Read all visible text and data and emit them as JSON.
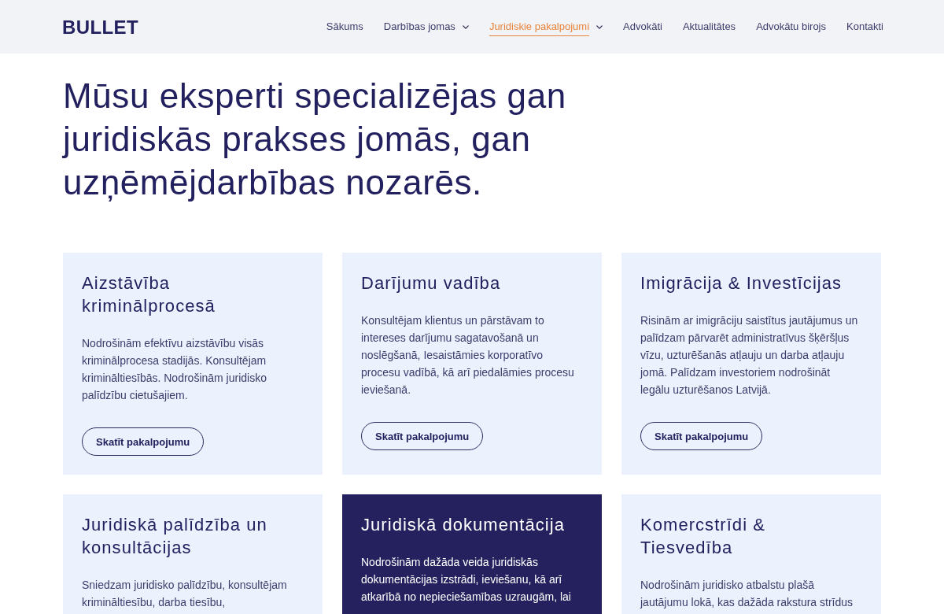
{
  "header": {
    "logo": "BULLET",
    "nav": [
      {
        "label": "Sākums",
        "selected": false,
        "dropdown": false
      },
      {
        "label": "Darbības jomas",
        "selected": false,
        "dropdown": true
      },
      {
        "label": "Juridiskie pakalpojumi",
        "selected": true,
        "dropdown": true
      },
      {
        "label": "Advokāti",
        "selected": false,
        "dropdown": false
      },
      {
        "label": "Aktualitātes",
        "selected": false,
        "dropdown": false
      },
      {
        "label": "Advokātu birojs",
        "selected": false,
        "dropdown": false
      },
      {
        "label": "Kontakti",
        "selected": false,
        "dropdown": false
      }
    ]
  },
  "hero": {
    "heading": "Mūsu eksperti specializējas gan juridiskās prakses jomās, gan uzņēmējdarbības nozarēs."
  },
  "cards": [
    {
      "title": "Aizstāvība kriminālprocesā",
      "text": "Nodrošinām efektīvu aizstāvību visās kriminālprocesa stadijās. Konsultējam krimināltiesībās. Nodrošinām juridisko palīdzību cietušajiem.",
      "button": "Skatīt pakalpojumu",
      "highlighted": false
    },
    {
      "title": "Darījumu vadība",
      "text": "Konsultējam klientus un pārstāvam to intereses darījumu sagatavošanā un noslēgšanā, Iesaistāmies korporatīvo procesu vadībā, kā arī piedalāmies procesu ieviešanā.",
      "button": "Skatīt pakalpojumu",
      "highlighted": false
    },
    {
      "title": "Imigrācija & Investīcijas",
      "text": "Risinām ar imigrāciju saistītus jautājumus un palīdzam pārvarēt administratīvus šķēršļus vīzu, uzturēšanās atļauju un darba atļauju jomā. Palīdzam investoriem nodrošināt legālu uzturēšanos Latvijā.",
      "button": "Skatīt pakalpojumu",
      "highlighted": false
    },
    {
      "title": "Juridiskā palīdzība un konsultācijas",
      "text": "Sniedzam juridisko palīdzību, konsultējam krimināltiesību, darba tiesību,",
      "highlighted": false
    },
    {
      "title": "Juridiskā dokumentācija",
      "text": "Nodrošinām dažāda veida juridiskās dokumentācijas izstrādi, ieviešanu, kā arī atkarībā no nepieciešamības uzraugām, lai",
      "highlighted": true
    },
    {
      "title": "Komercstrīdi & Tiesvedība",
      "text": "Nodrošinām juridisko atbalstu plašā jautājumu lokā, kas dažāda rakstura strīdus",
      "highlighted": false
    }
  ]
}
